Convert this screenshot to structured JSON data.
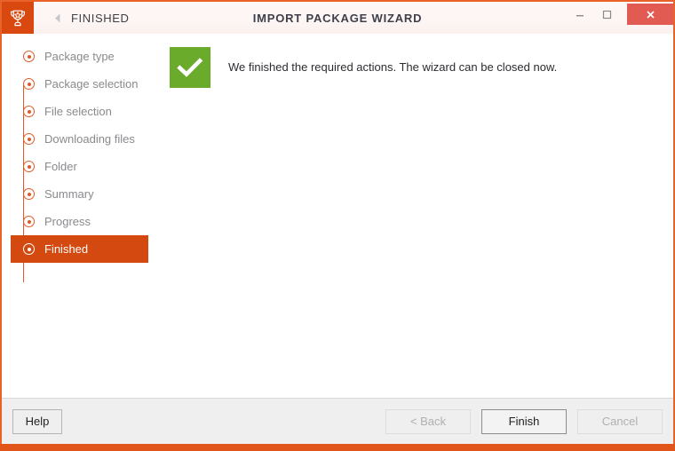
{
  "window": {
    "app_icon": "trophy-icon",
    "step_name": "FINISHED",
    "wizard_title": "IMPORT PACKAGE WIZARD",
    "back_arrow_icon": "chevron-left-icon",
    "controls": {
      "minimize_icon": "minimize-icon",
      "maximize_icon": "maximize-icon",
      "close_icon": "close-icon"
    },
    "accent_color": "#e2551a",
    "close_button_color": "#e25b53"
  },
  "sidebar": {
    "steps": [
      {
        "label": "Package type",
        "active": false
      },
      {
        "label": "Package selection",
        "active": false
      },
      {
        "label": "File selection",
        "active": false
      },
      {
        "label": "Downloading files",
        "active": false
      },
      {
        "label": "Folder",
        "active": false
      },
      {
        "label": "Summary",
        "active": false
      },
      {
        "label": "Progress",
        "active": false
      },
      {
        "label": "Finished",
        "active": true
      }
    ],
    "active_color": "#d4490f",
    "marker_color": "#e05a28"
  },
  "content": {
    "result_icon": "checkmark-icon",
    "result_icon_color": "#6aab2b",
    "message": "We finished the required actions. The wizard can be closed now."
  },
  "footer": {
    "help_label": "Help",
    "back_label": "< Back",
    "finish_label": "Finish",
    "cancel_label": "Cancel"
  }
}
